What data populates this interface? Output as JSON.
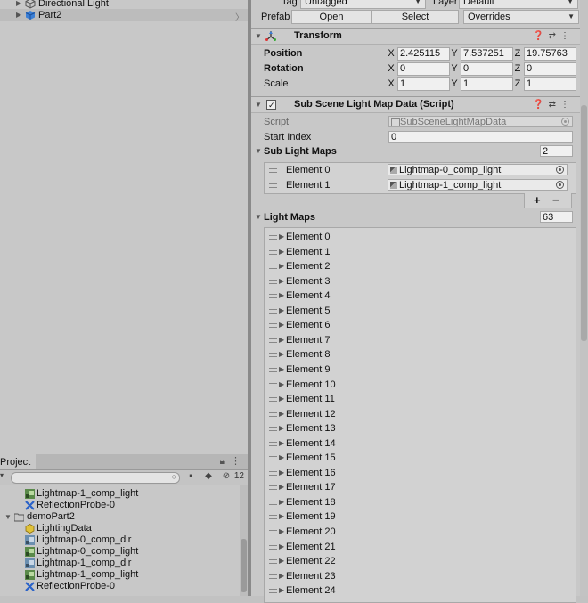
{
  "hierarchy": {
    "items": [
      {
        "label": "Directional Light",
        "icon": "cube-outline-icon"
      },
      {
        "label": "Part2",
        "icon": "cube-blue-icon"
      }
    ]
  },
  "project": {
    "tab_label": "Project",
    "hidden_count": "12",
    "items": [
      {
        "label": "Lightmap-1_comp_light",
        "icon": "lightmap-texture-icon",
        "indent": 2
      },
      {
        "label": "ReflectionProbe-0",
        "icon": "reflection-probe-icon",
        "indent": 2
      },
      {
        "label": "demoPart2",
        "icon": "folder-icon",
        "indent": 0
      },
      {
        "label": "LightingData",
        "icon": "lighting-data-icon",
        "indent": 2
      },
      {
        "label": "Lightmap-0_comp_dir",
        "icon": "lightmap-texture-icon",
        "indent": 2
      },
      {
        "label": "Lightmap-0_comp_light",
        "icon": "lightmap-texture-icon",
        "indent": 2
      },
      {
        "label": "Lightmap-1_comp_dir",
        "icon": "lightmap-texture-icon",
        "indent": 2
      },
      {
        "label": "Lightmap-1_comp_light",
        "icon": "lightmap-texture-icon",
        "indent": 2
      },
      {
        "label": "ReflectionProbe-0",
        "icon": "reflection-probe-icon",
        "indent": 2
      }
    ]
  },
  "inspector": {
    "tag_label": "Tag",
    "tag_value": "Untagged",
    "layer_label": "Layer",
    "layer_value": "Default",
    "prefab_label": "Prefab",
    "open_label": "Open",
    "select_label": "Select",
    "overrides_label": "Overrides",
    "transform": {
      "title": "Transform",
      "position_label": "Position",
      "rotation_label": "Rotation",
      "scale_label": "Scale",
      "position": {
        "x": "2.425115",
        "y": "7.537251",
        "z": "19.75763"
      },
      "rotation": {
        "x": "0",
        "y": "0",
        "z": "0"
      },
      "scale": {
        "x": "1",
        "y": "1",
        "z": "1"
      },
      "axis_x": "X",
      "axis_y": "Y",
      "axis_z": "Z"
    },
    "script_component": {
      "title": "Sub Scene Light Map Data (Script)",
      "script_label": "Script",
      "script_value": "SubSceneLightMapData",
      "start_index_label": "Start Index",
      "start_index_value": "0",
      "sub_light_maps_label": "Sub Light Maps",
      "sub_light_maps_count": "2",
      "sub_light_maps": [
        {
          "label": "Element 0",
          "value": "Lightmap-0_comp_light"
        },
        {
          "label": "Element 1",
          "value": "Lightmap-1_comp_light"
        }
      ],
      "add_label": "+",
      "remove_label": "−",
      "light_maps_label": "Light Maps",
      "light_maps_count": "63",
      "light_maps": [
        "Element 0",
        "Element 1",
        "Element 2",
        "Element 3",
        "Element 4",
        "Element 5",
        "Element 6",
        "Element 7",
        "Element 8",
        "Element 9",
        "Element 10",
        "Element 11",
        "Element 12",
        "Element 13",
        "Element 14",
        "Element 15",
        "Element 16",
        "Element 17",
        "Element 18",
        "Element 19",
        "Element 20",
        "Element 21",
        "Element 22",
        "Element 23",
        "Element 24"
      ]
    }
  }
}
